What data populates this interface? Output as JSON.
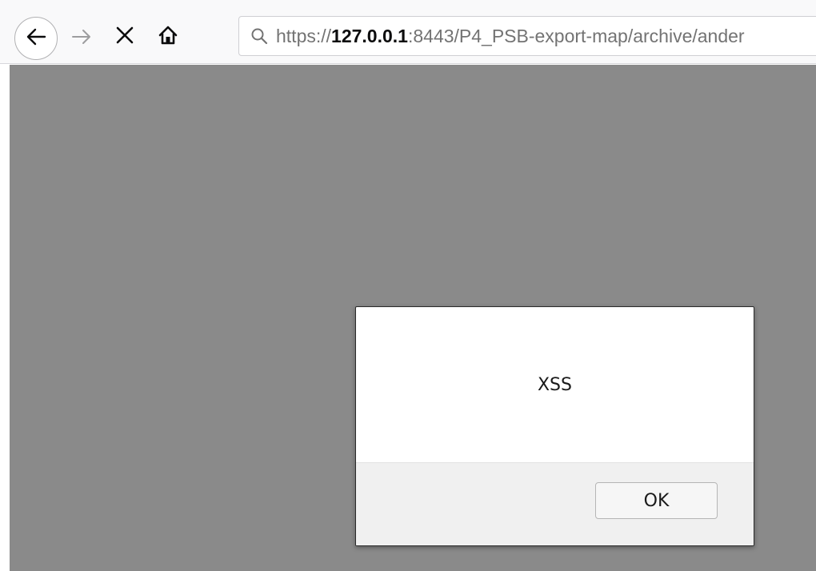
{
  "browser": {
    "toolbar": {
      "back_icon": "arrow-left-icon",
      "forward_icon": "arrow-right-icon",
      "stop_icon": "close-icon",
      "home_icon": "home-icon"
    },
    "urlbar": {
      "icon": "search-icon",
      "scheme": "https://",
      "host": "127.0.0.1",
      "rest": ":8443/P4_PSB-export-map/archive/ander"
    }
  },
  "page": {
    "background_color": "#8a8a8a"
  },
  "dialog": {
    "message": "XSS",
    "ok_label": "OK"
  }
}
